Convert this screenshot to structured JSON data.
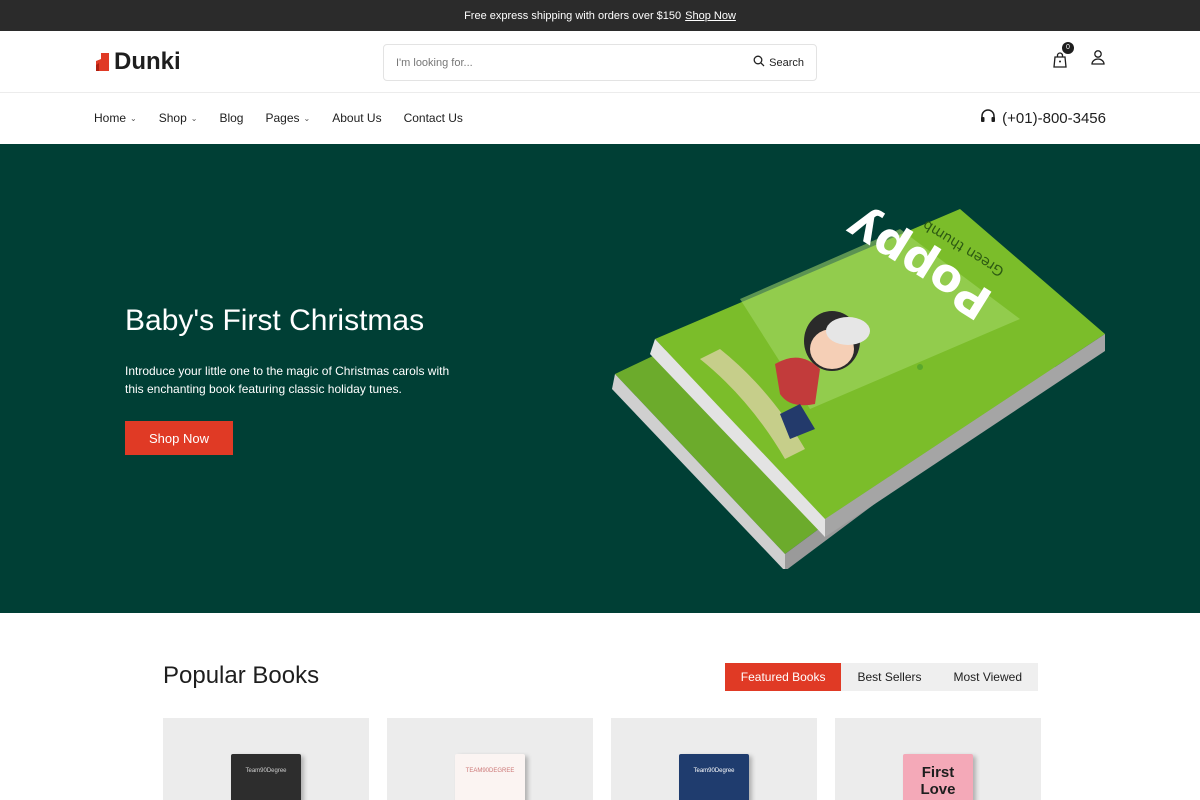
{
  "topbar": {
    "message": "Free express shipping with orders over $150",
    "link": "Shop Now"
  },
  "header": {
    "logo": "Dunki",
    "search_placeholder": "I'm looking for...",
    "search_button": "Search",
    "cart_count": "0"
  },
  "nav": {
    "items": [
      {
        "label": "Home",
        "has_dropdown": true
      },
      {
        "label": "Shop",
        "has_dropdown": true
      },
      {
        "label": "Blog",
        "has_dropdown": false
      },
      {
        "label": "Pages",
        "has_dropdown": true
      },
      {
        "label": "About Us",
        "has_dropdown": false
      },
      {
        "label": "Contact Us",
        "has_dropdown": false
      }
    ],
    "phone": "(+01)-800-3456"
  },
  "hero": {
    "title": "Baby's First Christmas",
    "subtitle": "Introduce your little one to the magic of Christmas carols with this enchanting book featuring classic holiday tunes.",
    "button": "Shop Now",
    "book_title": "Poppy",
    "book_subtitle": "Green thumb"
  },
  "popular": {
    "title": "Popular Books",
    "tabs": [
      {
        "label": "Featured Books",
        "active": true
      },
      {
        "label": "Best Sellers",
        "active": false
      },
      {
        "label": "Most Viewed",
        "active": false
      }
    ],
    "products": [
      {
        "cover_text": "Team90Degree",
        "cover_color": "#2d2d2d",
        "text_color": "#cfcfcf"
      },
      {
        "cover_text": "TEAM90DEGREE",
        "cover_color": "#fbf4f2",
        "text_color": "#c77"
      },
      {
        "cover_text": "Team90Degree",
        "cover_color": "#1f3c6e",
        "text_color": "#ffffff"
      },
      {
        "cover_text": "First Love",
        "cover_color": "#f4a9b8",
        "text_color": "#1e1e1e"
      }
    ]
  },
  "colors": {
    "accent": "#e03a25",
    "hero_bg": "#003f35",
    "topbar_bg": "#2b2b2b"
  }
}
